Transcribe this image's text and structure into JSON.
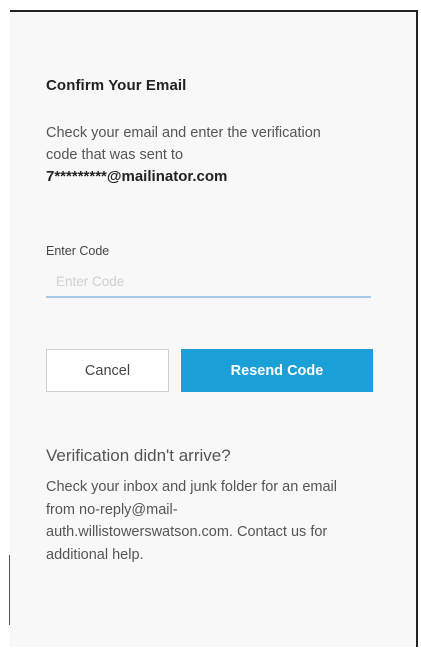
{
  "dialog": {
    "title": "Confirm Your Email",
    "instructions": "Check your email and enter the verification code that was sent to",
    "masked_email": "7*********@mailinator.com"
  },
  "code": {
    "label": "Enter Code",
    "placeholder": "Enter Code",
    "value": ""
  },
  "buttons": {
    "cancel_label": "Cancel",
    "resend_label": "Resend Code"
  },
  "help": {
    "heading": "Verification didn't arrive?",
    "text": "Check your inbox and junk folder for an email from no-reply@mail-auth.willistowerswatson.com. Contact us for additional help."
  },
  "colors": {
    "primary": "#1a9fd6",
    "input_underline": "#a9c7e6",
    "dialog_background": "#f8f8f8"
  }
}
